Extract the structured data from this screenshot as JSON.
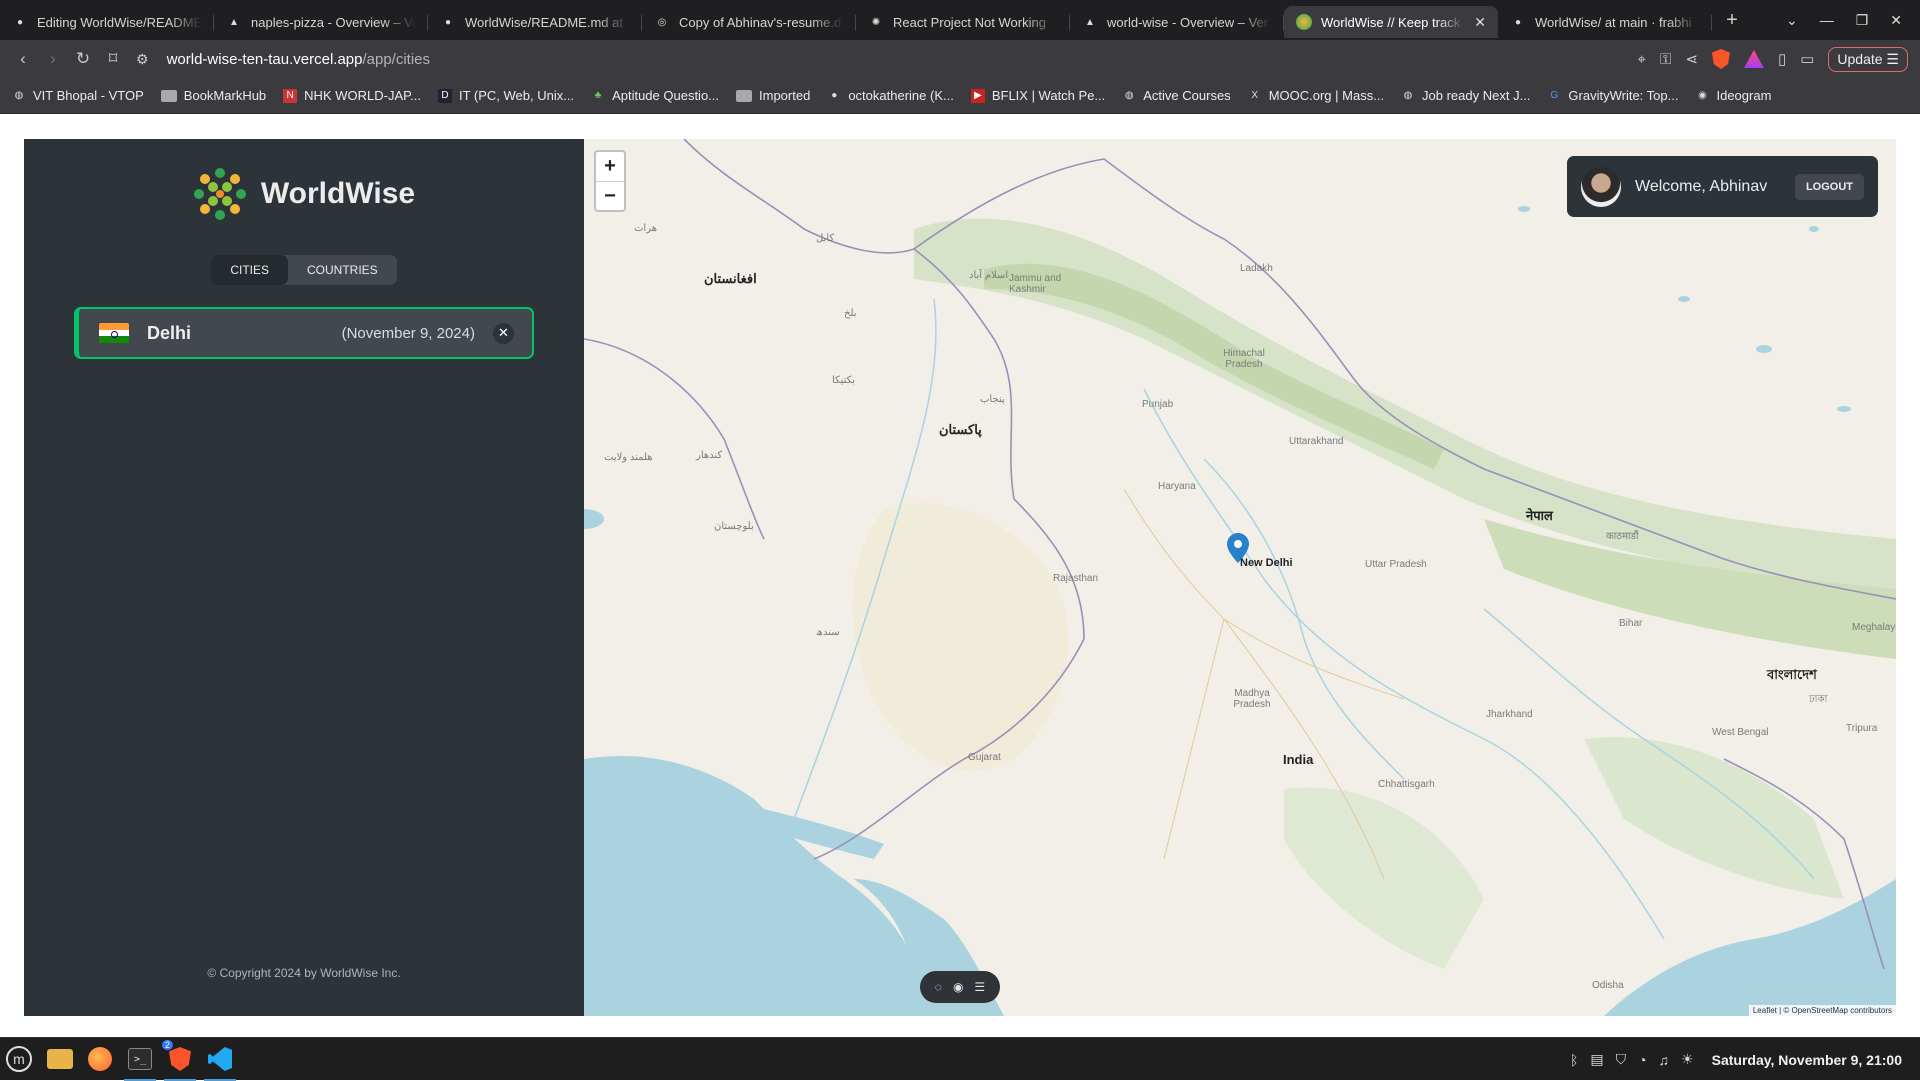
{
  "browser": {
    "tabs": [
      {
        "title": "Editing WorldWise/README",
        "icon": "github-icon",
        "active": false
      },
      {
        "title": "naples-pizza - Overview – Ve",
        "icon": "vercel-icon",
        "active": false
      },
      {
        "title": "WorldWise/README.md at",
        "icon": "github-icon",
        "active": false
      },
      {
        "title": "Copy of Abhinav's-resume.d",
        "icon": "document-icon",
        "active": false
      },
      {
        "title": "React Project Not Working",
        "icon": "openai-icon",
        "active": false
      },
      {
        "title": "world-wise - Overview – Ver",
        "icon": "vercel-icon",
        "active": false
      },
      {
        "title": "WorldWise // Keep track",
        "icon": "worldwise-icon",
        "active": true
      },
      {
        "title": "WorldWise/ at main · frabhi",
        "icon": "github-icon",
        "active": false
      }
    ],
    "url": {
      "host": "world-wise-ten-tau.vercel.app",
      "path": "/app/cities"
    },
    "update_label": "Update",
    "bookmarks": [
      {
        "label": "VIT Bhopal - VTOP",
        "icon": "globe-icon"
      },
      {
        "label": "BookMarkHub",
        "icon": "folder-icon"
      },
      {
        "label": "NHK WORLD-JAP...",
        "icon": "nhk-icon"
      },
      {
        "label": "IT (PC, Web, Unix...",
        "icon": "d-icon"
      },
      {
        "label": "Aptitude Questio...",
        "icon": "leaf-icon"
      },
      {
        "label": "Imported",
        "icon": "folder-icon"
      },
      {
        "label": "octokatherine (K...",
        "icon": "github-icon"
      },
      {
        "label": "BFLIX | Watch Pe...",
        "icon": "bflix-icon"
      },
      {
        "label": "Active Courses",
        "icon": "globe-icon"
      },
      {
        "label": "MOOC.org | Mass...",
        "icon": "x-icon"
      },
      {
        "label": "Job ready Next J...",
        "icon": "globe-icon"
      },
      {
        "label": "GravityWrite: Top...",
        "icon": "g-icon"
      },
      {
        "label": "Ideogram",
        "icon": "ideogram-icon"
      }
    ]
  },
  "app": {
    "name": "WorldWise",
    "tabs": {
      "cities": "Cities",
      "countries": "Countries"
    },
    "cities": [
      {
        "name": "Delhi",
        "date": "(November 9, 2024)",
        "flag": "india-flag"
      }
    ],
    "copyright": "© Copyright 2024 by WorldWise Inc.",
    "user": {
      "welcome": "Welcome, Abhinav",
      "logout": "Logout"
    },
    "map": {
      "zoom_in": "+",
      "zoom_out": "−",
      "marker_label": "New Delhi",
      "labels": [
        "افغانستان",
        "کابل",
        "اسلام آباد",
        "Jammu and Kashmir",
        "Ladakh",
        "Himachal Pradesh",
        "Punjab",
        "پنجاب",
        "پاکستان",
        "Uttarakhand",
        "Haryana",
        "नेपाल",
        "काठमाडौं",
        "Rajasthan",
        "Uttar Pradesh",
        "بلوچستان",
        "سندھ",
        "Bihar",
        "Meghalaya",
        "বাংলাদেশ",
        "ঢাকা",
        "Madhya Pradesh",
        "Jharkhand",
        "West Bengal",
        "Gujarat",
        "Chhattisgarh",
        "India",
        "Odisha",
        "Tripura",
        "بلخ",
        "کندهار",
        "هلمند ولایت",
        "هرات",
        "بکتیکا"
      ],
      "attribution": "Leaflet | © OpenStreetMap contributors"
    }
  },
  "taskbar": {
    "apps": [
      "files-icon",
      "firefox-icon",
      "terminal-icon",
      "brave-icon",
      "vscode-icon"
    ],
    "brave_badge": "2",
    "clock": "Saturday, November  9, 21:00"
  },
  "colors": {
    "sidebar": "#2d3439",
    "accent": "#00c46a",
    "map_water": "#aad3df"
  }
}
